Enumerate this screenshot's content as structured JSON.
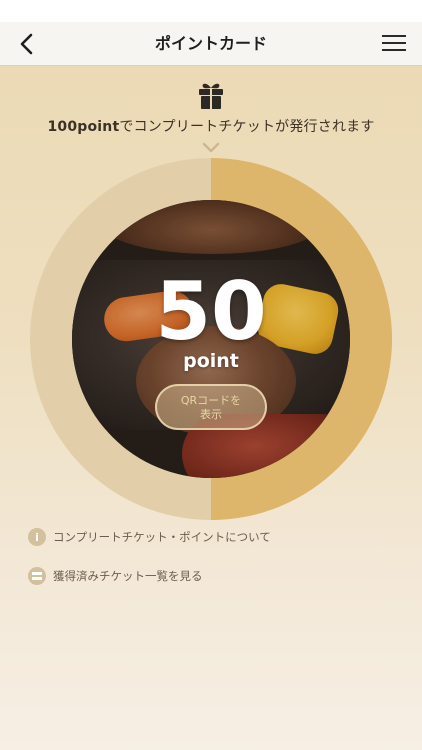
{
  "header": {
    "title": "ポイントカード",
    "back_icon": "chevron-left-icon",
    "menu_icon": "hamburger-menu-icon"
  },
  "banner": {
    "icon": "gift-icon",
    "points_required": "100point",
    "message": "でコンプリートチケットが発行されます",
    "chevron_icon": "chevron-down-icon"
  },
  "card": {
    "points": "50",
    "unit": "point",
    "progress": 0.5,
    "qr_button_label": "QRコードを\n表示",
    "colors": {
      "ring_track": "#e2cfaa",
      "ring_fill": "#ddb56b"
    }
  },
  "links": [
    {
      "icon": "info-icon",
      "label": "コンプリートチケット・ポイントについて"
    },
    {
      "icon": "ticket-icon",
      "label": "獲得済みチケット一覧を見る"
    }
  ]
}
